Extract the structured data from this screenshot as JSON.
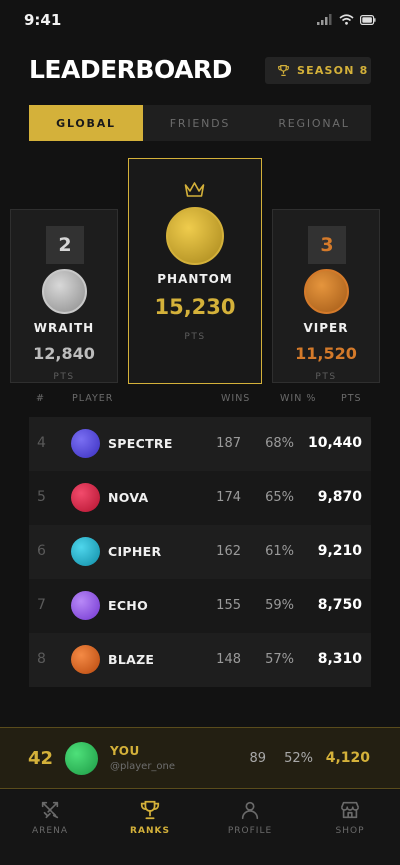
{
  "status_bar": {
    "time": "9:41"
  },
  "header": {
    "title": "LEADERBOARD",
    "season_label": "SEASON 8"
  },
  "tabs": [
    {
      "label": "GLOBAL",
      "active": true
    },
    {
      "label": "FRIENDS",
      "active": false
    },
    {
      "label": "REGIONAL",
      "active": false
    }
  ],
  "podium": {
    "first": {
      "name": "PHANTOM",
      "points": "15,230",
      "pts_label": "PTS"
    },
    "second": {
      "rank": "2",
      "name": "WRAITH",
      "points": "12,840",
      "pts_label": "PTS"
    },
    "third": {
      "rank": "3",
      "name": "VIPER",
      "points": "11,520",
      "pts_label": "PTS"
    }
  },
  "table": {
    "headers": {
      "rank": "#",
      "player": "PLAYER",
      "wins": "WINS",
      "win_pct": "WIN %",
      "points": "PTS"
    },
    "rows": [
      {
        "rank": "4",
        "name": "SPECTRE",
        "wins": "187",
        "win_pct": "68%",
        "points": "10,440",
        "color": "#5b4ee0"
      },
      {
        "rank": "5",
        "name": "NOVA",
        "wins": "174",
        "win_pct": "65%",
        "points": "9,870",
        "color": "#e0234a"
      },
      {
        "rank": "6",
        "name": "CIPHER",
        "wins": "162",
        "win_pct": "61%",
        "points": "9,210",
        "color": "#1fb7d4"
      },
      {
        "rank": "7",
        "name": "ECHO",
        "wins": "155",
        "win_pct": "59%",
        "points": "8,750",
        "color": "#9b5cf0"
      },
      {
        "rank": "8",
        "name": "BLAZE",
        "wins": "148",
        "win_pct": "57%",
        "points": "8,310",
        "color": "#ea6a1c"
      }
    ]
  },
  "current_user": {
    "rank": "42",
    "name": "YOU",
    "handle": "@player_one",
    "wins": "89",
    "win_pct": "52%",
    "points": "4,120"
  },
  "nav": [
    {
      "label": "ARENA",
      "icon": "swords-icon",
      "active": false
    },
    {
      "label": "RANKS",
      "icon": "trophy-icon",
      "active": true
    },
    {
      "label": "PROFILE",
      "icon": "user-icon",
      "active": false
    },
    {
      "label": "SHOP",
      "icon": "store-icon",
      "active": false
    }
  ],
  "colors": {
    "accent": "#d4b13a",
    "silver": "#bdbdbd",
    "bronze": "#d47a2a",
    "background": "#121212"
  }
}
